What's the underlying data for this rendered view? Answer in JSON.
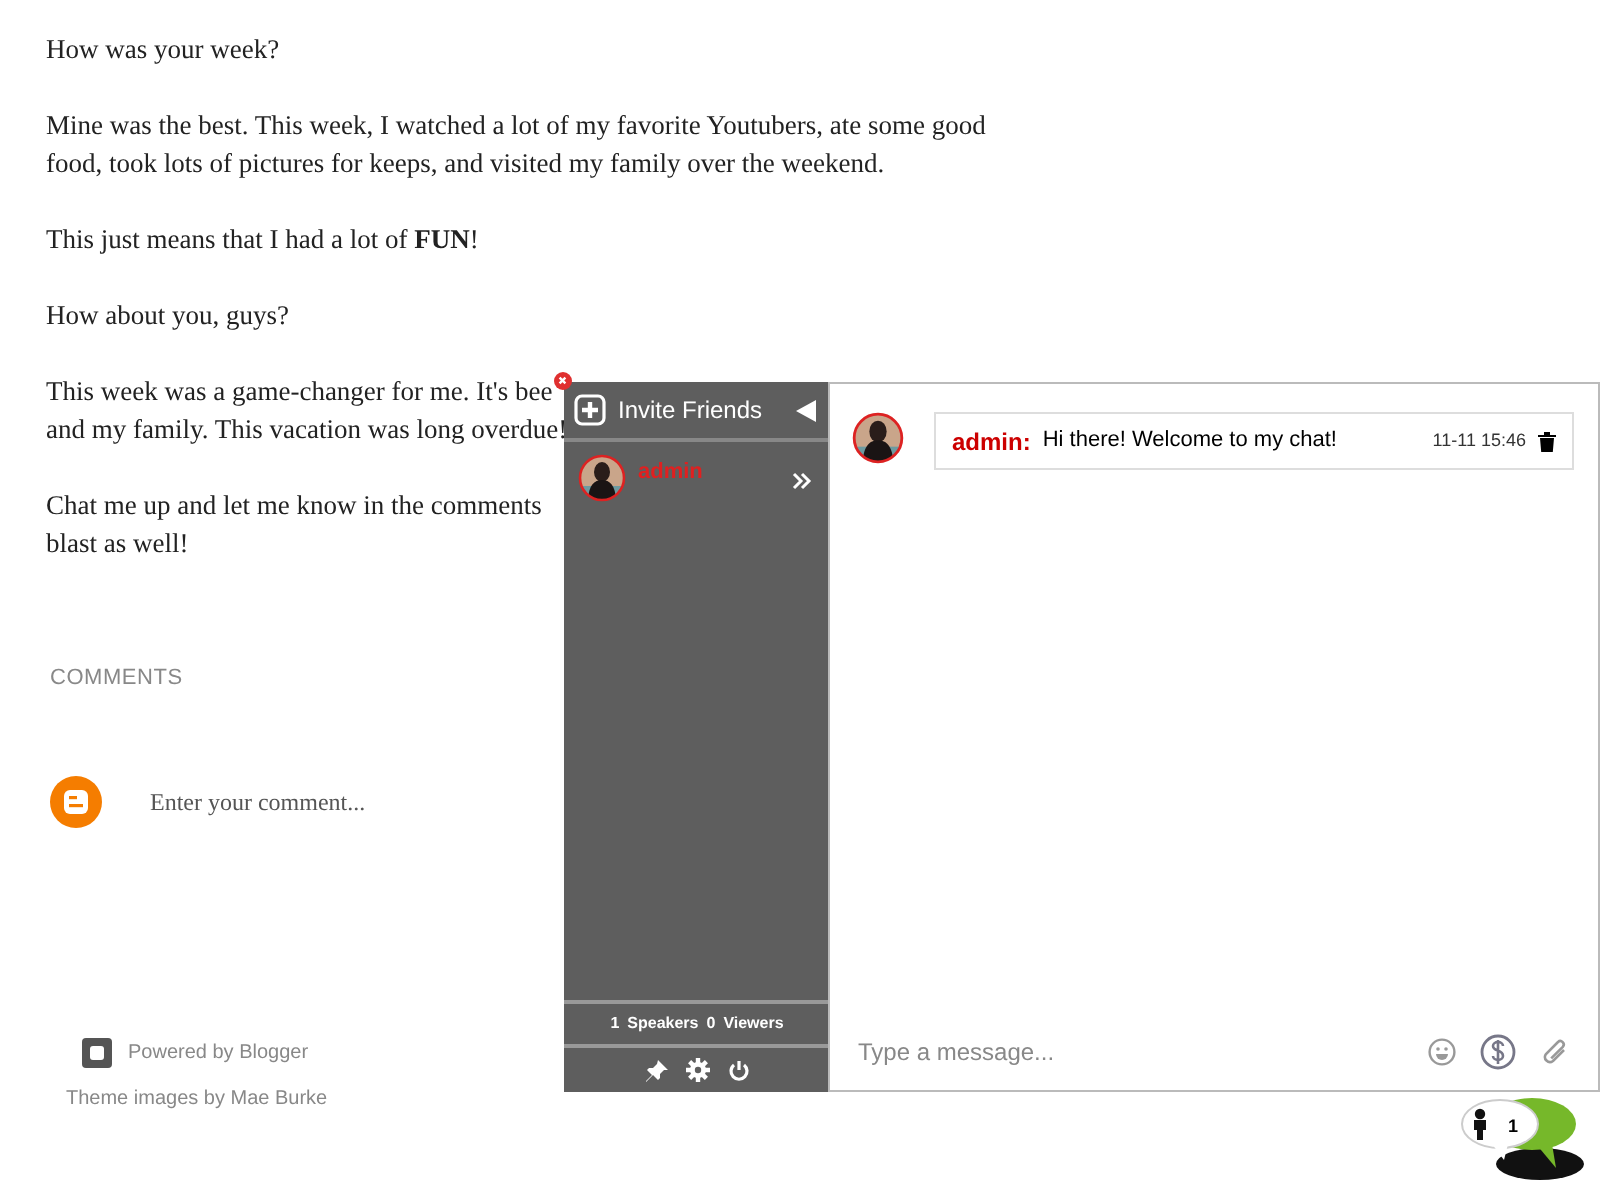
{
  "post": {
    "paragraphs": [
      {
        "lines": [
          "How was your week?"
        ]
      },
      {
        "lines": [
          "Mine was the best. This week, I watched a lot of my favorite Youtubers, ate some good",
          "food, took lots of pictures for keeps, and visited my family over the weekend."
        ]
      },
      {
        "lines": [
          "This just means that I had a lot of **FUN**!"
        ]
      },
      {
        "lines": [
          "How about you, guys?"
        ]
      },
      {
        "lines": [
          "This week was a game-changer for me. It's bee",
          "and my family. This vacation was long overdue!"
        ]
      },
      {
        "lines": [
          "Chat me up and let me know in the comments",
          "blast as well!"
        ]
      }
    ]
  },
  "comments": {
    "heading": "COMMENTS",
    "placeholder": "Enter your comment..."
  },
  "footer": {
    "powered": "Powered by Blogger",
    "theme": "Theme images by Mae Burke"
  },
  "chat": {
    "invite": "Invite Friends",
    "users": [
      {
        "name": "admin"
      }
    ],
    "stats": {
      "speakers_count": "1",
      "speakers_label": "Speakers",
      "viewers_count": "0",
      "viewers_label": "Viewers"
    },
    "messages": [
      {
        "author": "admin:",
        "text": "Hi there! Welcome to my chat!",
        "time": "11-11 15:46"
      }
    ],
    "input": {
      "placeholder": "Type a message..."
    },
    "badge": {
      "count": "1"
    }
  }
}
